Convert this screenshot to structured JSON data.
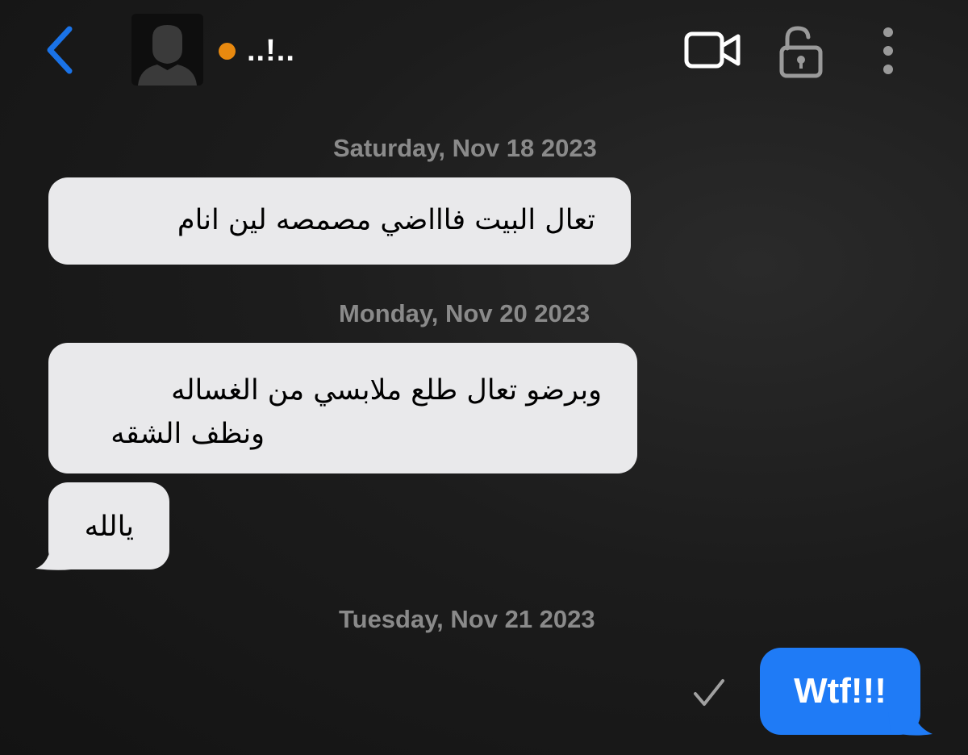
{
  "header": {
    "back_icon": "chevron-left-icon",
    "avatar_icon": "default-avatar-silhouette",
    "status_color": "#e8890f",
    "contact_name": "..!..",
    "video_icon": "video-camera-icon",
    "lock_icon": "unlocked-padlock-icon",
    "more_icon": "vertical-ellipsis-icon",
    "accent_color": "#1a73e8"
  },
  "conversation": {
    "date_1": "Saturday, Nov 18 2023",
    "message_1": "تعال البيت فاااضي مصمصه لين انام",
    "date_2": "Monday, Nov 20 2023",
    "message_2_line_1": "وبرضو تعال طلع ملابسي من الغساله",
    "message_2_line_2": "ونظف الشقه",
    "message_3": "يالله",
    "date_3": "Tuesday, Nov 21 2023",
    "outgoing_message": "Wtf!!!",
    "outgoing_status_icon": "checkmark-icon",
    "incoming_bubble_color": "#e9e9eb",
    "outgoing_bubble_color": "#1f7bf6"
  }
}
